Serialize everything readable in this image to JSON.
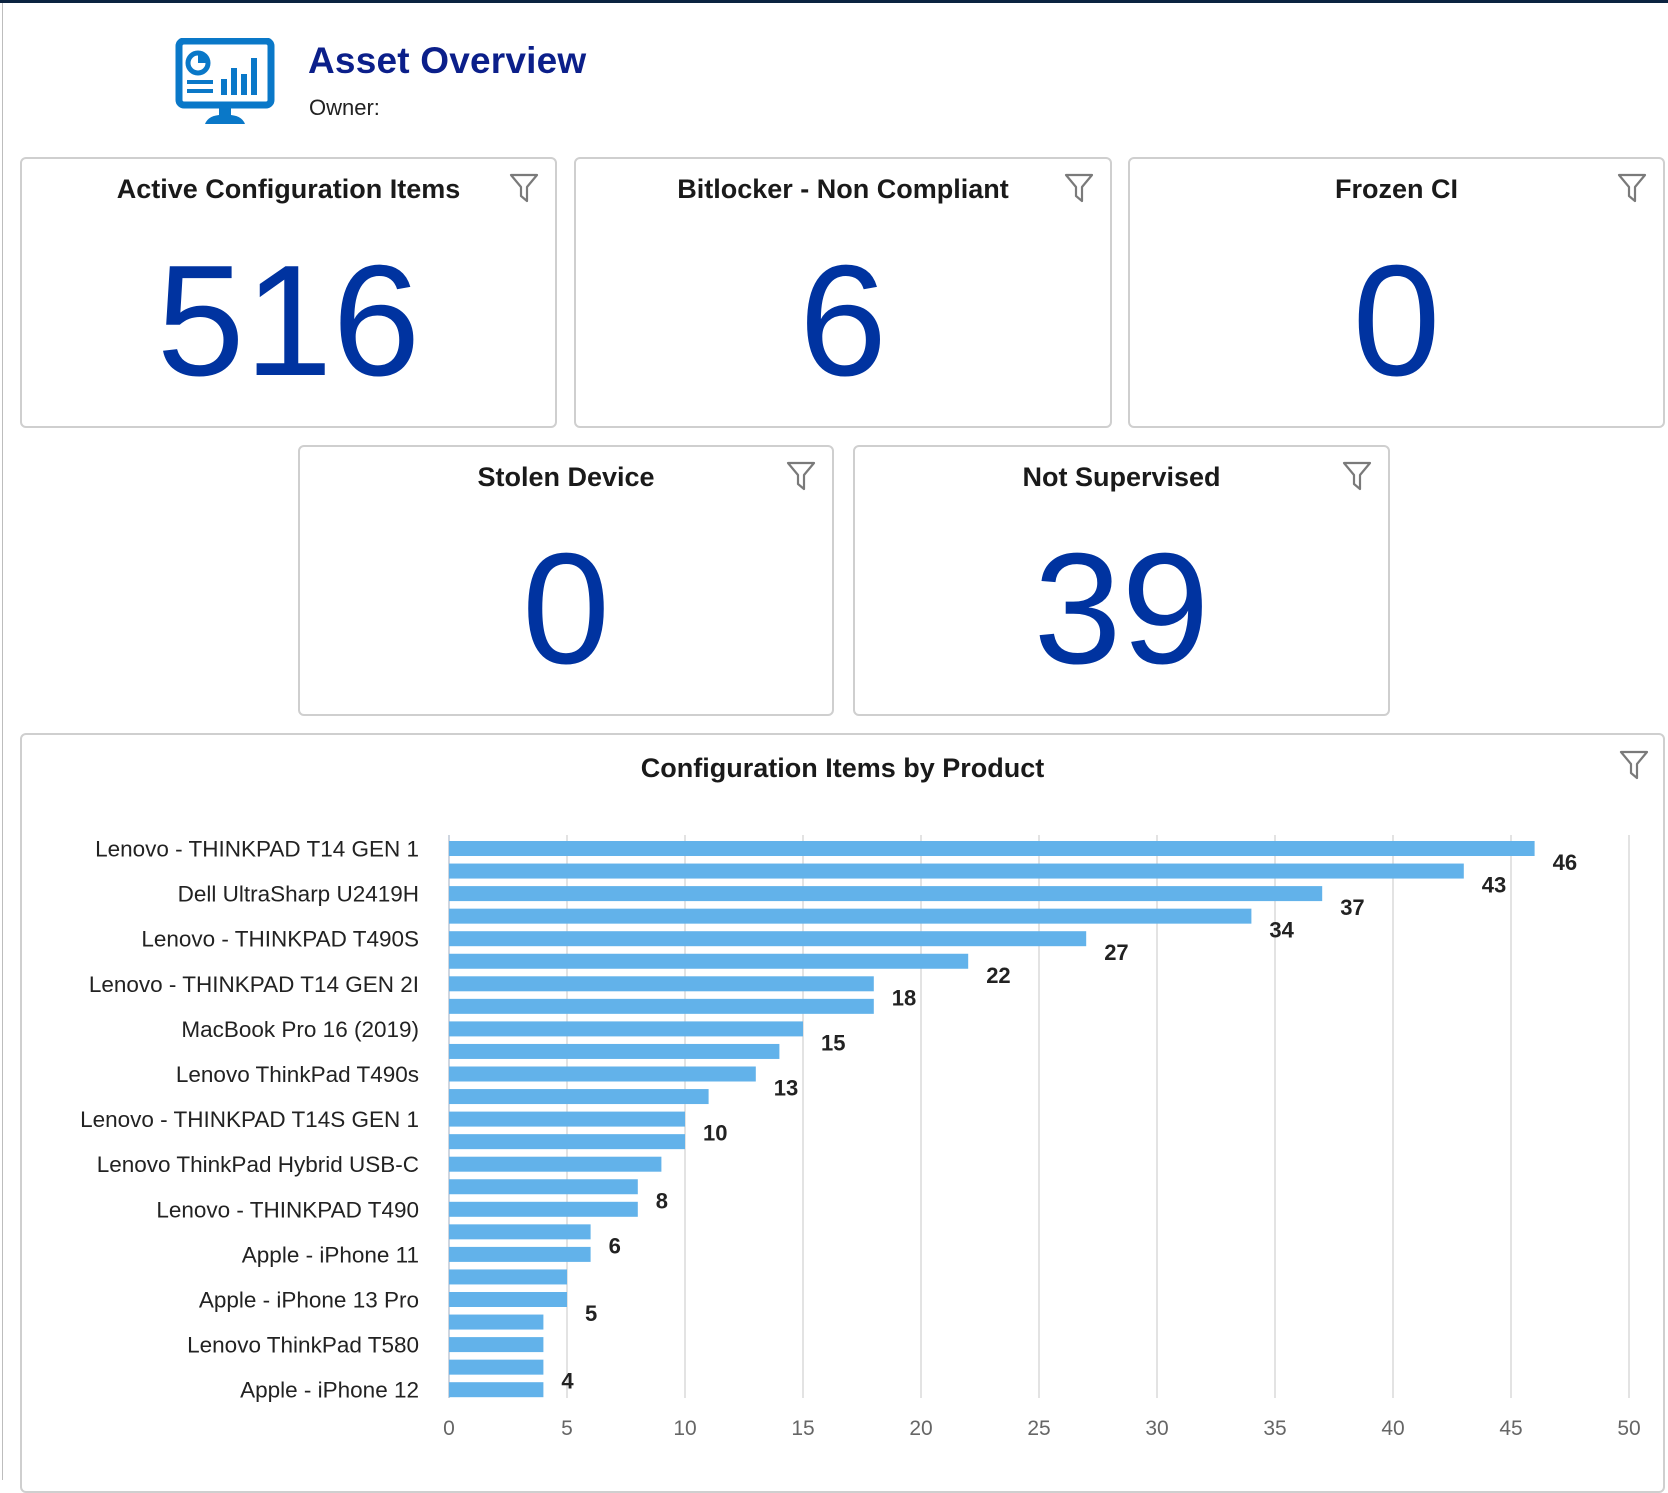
{
  "header": {
    "title": "Asset Overview",
    "owner_label": "Owner:",
    "owner_value": "",
    "icon": "monitor-dashboard-icon"
  },
  "colors": {
    "title": "#0b1f8a",
    "kpi_value": "#0033a0",
    "bar": "#62b2ea",
    "top_bar": "#0b2340",
    "icon": "#0a78c8"
  },
  "kpis": [
    {
      "title": "Active Configuration Items",
      "value": "516",
      "filter_icon": "filter-icon"
    },
    {
      "title": "Bitlocker - Non Compliant",
      "value": "6",
      "filter_icon": "filter-icon"
    },
    {
      "title": "Frozen CI",
      "value": "0",
      "filter_icon": "filter-icon"
    },
    {
      "title": "Stolen Device",
      "value": "0",
      "filter_icon": "filter-icon"
    },
    {
      "title": "Not Supervised",
      "value": "39",
      "filter_icon": "filter-icon"
    }
  ],
  "chart_data": {
    "type": "bar",
    "orientation": "horizontal",
    "title": "Configuration Items by Product",
    "xlabel": "",
    "ylabel": "",
    "xlim": [
      0,
      50
    ],
    "xticks": [
      "0",
      "5",
      "10",
      "15",
      "20",
      "25",
      "30",
      "35",
      "40",
      "45",
      "50"
    ],
    "grid": true,
    "legend": "none",
    "categories": [
      "Lenovo - THINKPAD T14 GEN 1",
      "",
      "Dell UltraSharp U2419H",
      "",
      "Lenovo - THINKPAD T490S",
      "",
      "Lenovo - THINKPAD T14 GEN 2I",
      "",
      "MacBook Pro 16 (2019)",
      "",
      "Lenovo ThinkPad T490s",
      "",
      "Lenovo - THINKPAD T14S GEN 1",
      "",
      "Lenovo ThinkPad Hybrid USB-C",
      "",
      "Lenovo - THINKPAD T490",
      "",
      "Apple - iPhone 11",
      "",
      "Apple - iPhone 13 Pro",
      "",
      "Lenovo ThinkPad T580",
      "",
      "Apple - iPhone 12"
    ],
    "values": [
      46,
      43,
      37,
      34,
      27,
      22,
      18,
      18,
      15,
      14,
      13,
      11,
      10,
      10,
      9,
      8,
      8,
      6,
      6,
      5,
      5,
      4,
      4,
      4,
      4
    ],
    "value_labels": [
      "46",
      "43",
      "37",
      "34",
      "27",
      "22",
      "18",
      "",
      "15",
      "",
      "13",
      "",
      "10",
      "",
      "",
      "8",
      "",
      "6",
      "",
      "",
      "5",
      "",
      "",
      "4",
      ""
    ]
  }
}
